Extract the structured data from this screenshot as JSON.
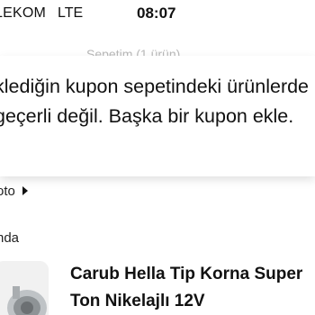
{
  "status_bar": {
    "carrier": "LEKOM",
    "network": "LTE",
    "time": "08:07"
  },
  "header": {
    "faint_title": "Sepetim (1 ürün)"
  },
  "toast": {
    "message": "klediğin kupon sepetindeki ürünlerde geçerli değil. Başka bir kupon ekle."
  },
  "cart": {
    "cargo_link_label": "oto",
    "seller_label": "nda",
    "product_title": "Carub Hella Tip Korna Super Ton Nikelajlı 12V"
  }
}
